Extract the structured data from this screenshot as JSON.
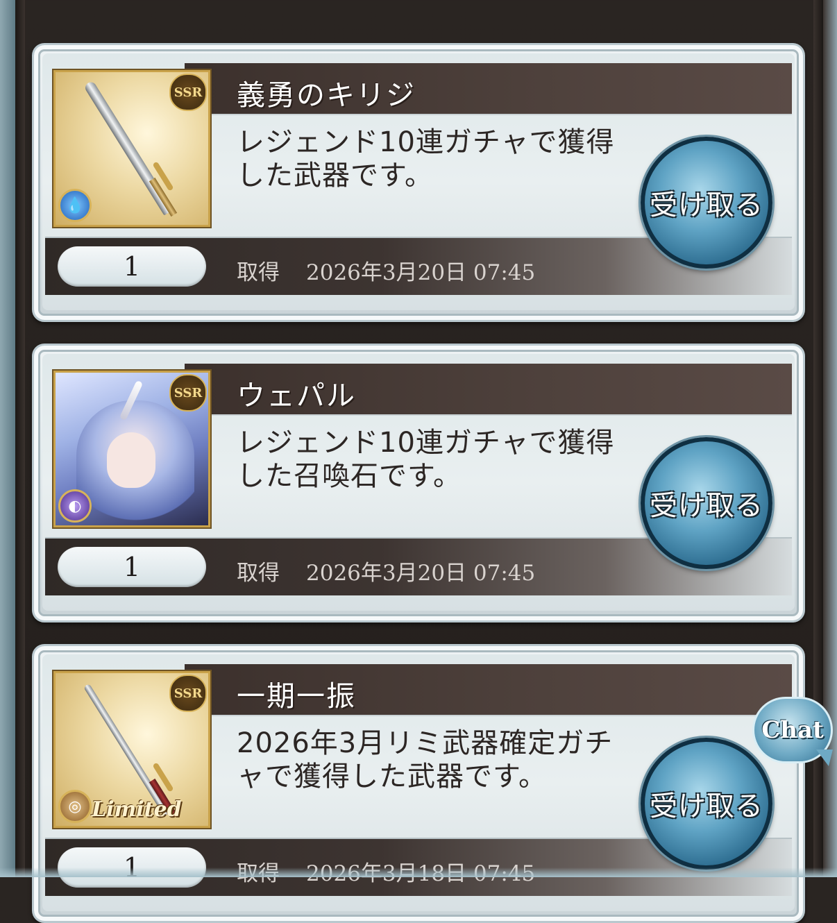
{
  "items": [
    {
      "name": "義勇のキリジ",
      "description": "レジェンド10連ガチャで獲得した武器です。",
      "quantity": "1",
      "acquired_label": "取得",
      "acquired_date": "2026年3月20日 07:45",
      "button_label": "受け取る",
      "rarity": "SSR",
      "element_icon": "water-element-icon",
      "type_icon": "sword-icon"
    },
    {
      "name": "ウェパル",
      "description": "レジェンド10連ガチャで獲得した召喚石です。",
      "quantity": "1",
      "acquired_label": "取得",
      "acquired_date": "2026年3月20日 07:45",
      "button_label": "受け取る",
      "rarity": "SSR",
      "element_icon": "dark-element-icon",
      "type_icon": "summon-portrait-icon"
    },
    {
      "name": "一期一振",
      "description": "2026年3月リミ武器確定ガチャで獲得した武器です。",
      "quantity": "1",
      "acquired_label": "取得",
      "acquired_date": "2026年3月18日 07:45",
      "button_label": "受け取る",
      "rarity": "SSR",
      "badge": "Limited",
      "element_icon": "earth-element-icon",
      "type_icon": "katana-icon"
    }
  ],
  "chat": {
    "label": "Chat"
  },
  "colors": {
    "title_bar": "#3b302c",
    "button_blue": "#2f6f92",
    "card_bg": "#e9eff0"
  }
}
